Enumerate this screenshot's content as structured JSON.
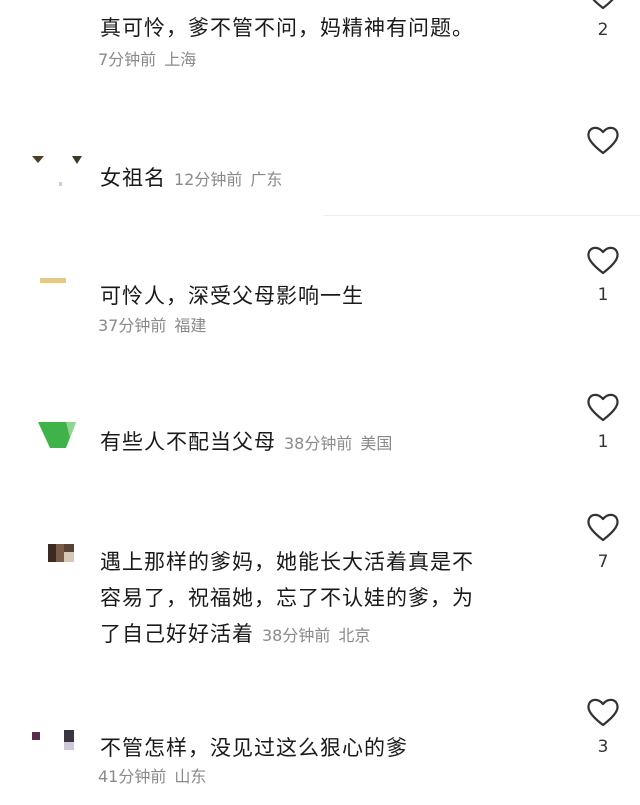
{
  "comments": [
    {
      "text": "真可怜，爹不管不问，妈精神有问题。",
      "time": "7分钟前",
      "location": "上海",
      "likes": "2"
    },
    {
      "text": "女祖名",
      "time": "12分钟前",
      "location": "广东",
      "likes": ""
    },
    {
      "text": "可怜人，深受父母影响一生",
      "time": "37分钟前",
      "location": "福建",
      "likes": "1"
    },
    {
      "text": "有些人不配当父母",
      "time": "38分钟前",
      "location": "美国",
      "likes": "1"
    },
    {
      "text_lines": [
        "遇上那样的爹妈，她能长大活着真是不",
        "容易了，祝福她，忘了不认娃的爹，为",
        "了自己好好活着"
      ],
      "time": "38分钟前",
      "location": "北京",
      "likes": "7"
    },
    {
      "text": "不管怎样，没见过这么狠心的爹",
      "time": "41分钟前",
      "location": "山东",
      "likes": "3"
    }
  ],
  "icons": {
    "like": "heart-outline-icon"
  },
  "colors": {
    "text": "#1a1a1a",
    "meta": "#8a8a8a",
    "avatar_green": "#4caf50"
  }
}
